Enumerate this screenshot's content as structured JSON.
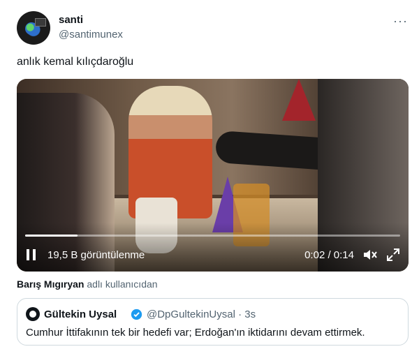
{
  "author": {
    "display_name": "santi",
    "handle": "@santimunex"
  },
  "tweet": {
    "text": "anlık kemal kılıçdaroğlu",
    "more_icon": "more-horizontal-icon"
  },
  "video": {
    "views": "19,5 B görüntülenme",
    "time": "0:02 / 0:14",
    "progress_fraction": 0.14,
    "icons": [
      "pause-icon",
      "mute-icon",
      "fullscreen-icon"
    ]
  },
  "attribution": {
    "user": "Barış Mıgıryan",
    "suffix": "adlı kullanıcıdan"
  },
  "quote": {
    "name": "Gültekin Uysal",
    "handle_time": "@DpGultekinUysal · 3s",
    "text": "Cumhur İttifakının tek bir hedefi var; Erdoğan'ın iktidarını devam ettirmek.",
    "verified_color": "#1d9bf0"
  }
}
